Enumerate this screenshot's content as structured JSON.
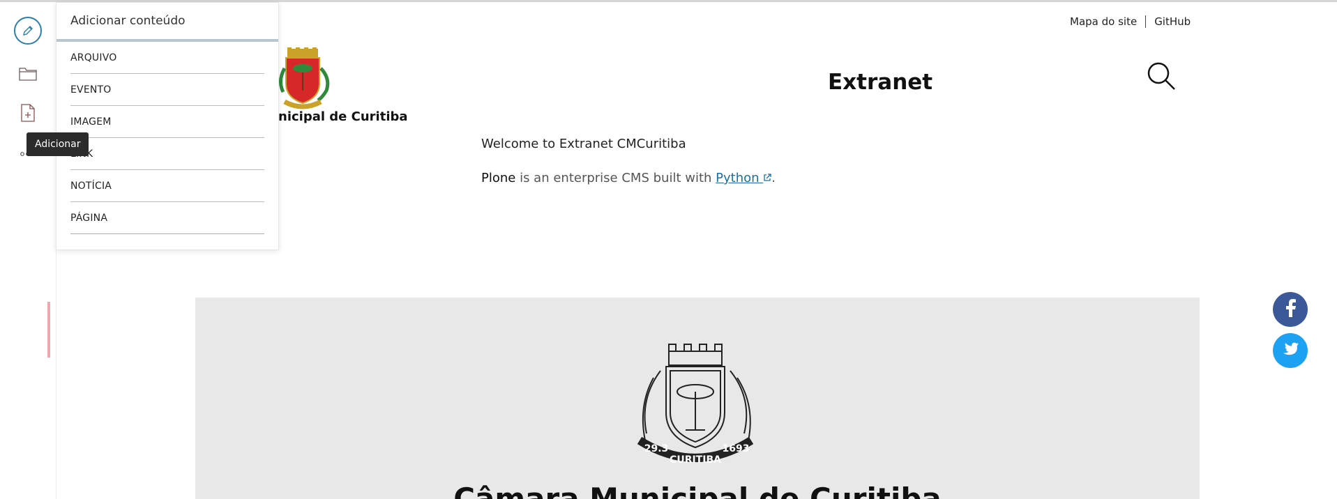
{
  "toolbar": {
    "tooltip": "Adicionar"
  },
  "add_menu": {
    "title": "Adicionar conteúdo",
    "items": [
      {
        "label": "ARQUIVO"
      },
      {
        "label": "EVENTO"
      },
      {
        "label": "IMAGEM"
      },
      {
        "label": "LINK"
      },
      {
        "label": "NOTÍCIA"
      },
      {
        "label": "PÁGINA"
      }
    ]
  },
  "header": {
    "links": {
      "sitemap": "Mapa do site",
      "github": "GitHub"
    },
    "org_name": "nicipal de Curitiba",
    "site_title": "Extranet"
  },
  "main": {
    "welcome": "Welcome to Extranet CMCuritiba",
    "intro_strong": "Plone",
    "intro_text": " is an enterprise CMS built with ",
    "intro_link": "Python",
    "intro_end": "."
  },
  "banner": {
    "crest_ribbon": "CURITIBA",
    "crest_left": "29.3",
    "crest_right": "1693",
    "title": "Câmara Municipal de Curitiba"
  },
  "colors": {
    "accent": "#2a7fa8",
    "facebook": "#3b5998",
    "twitter": "#1da1f2",
    "banner_bg": "#e8e8e8"
  },
  "icons": {
    "toolbar": [
      "pencil-icon",
      "folder-icon",
      "add-file-icon",
      "more-icon"
    ],
    "header": [
      "search-icon"
    ],
    "social": [
      "facebook-icon",
      "twitter-icon"
    ]
  }
}
